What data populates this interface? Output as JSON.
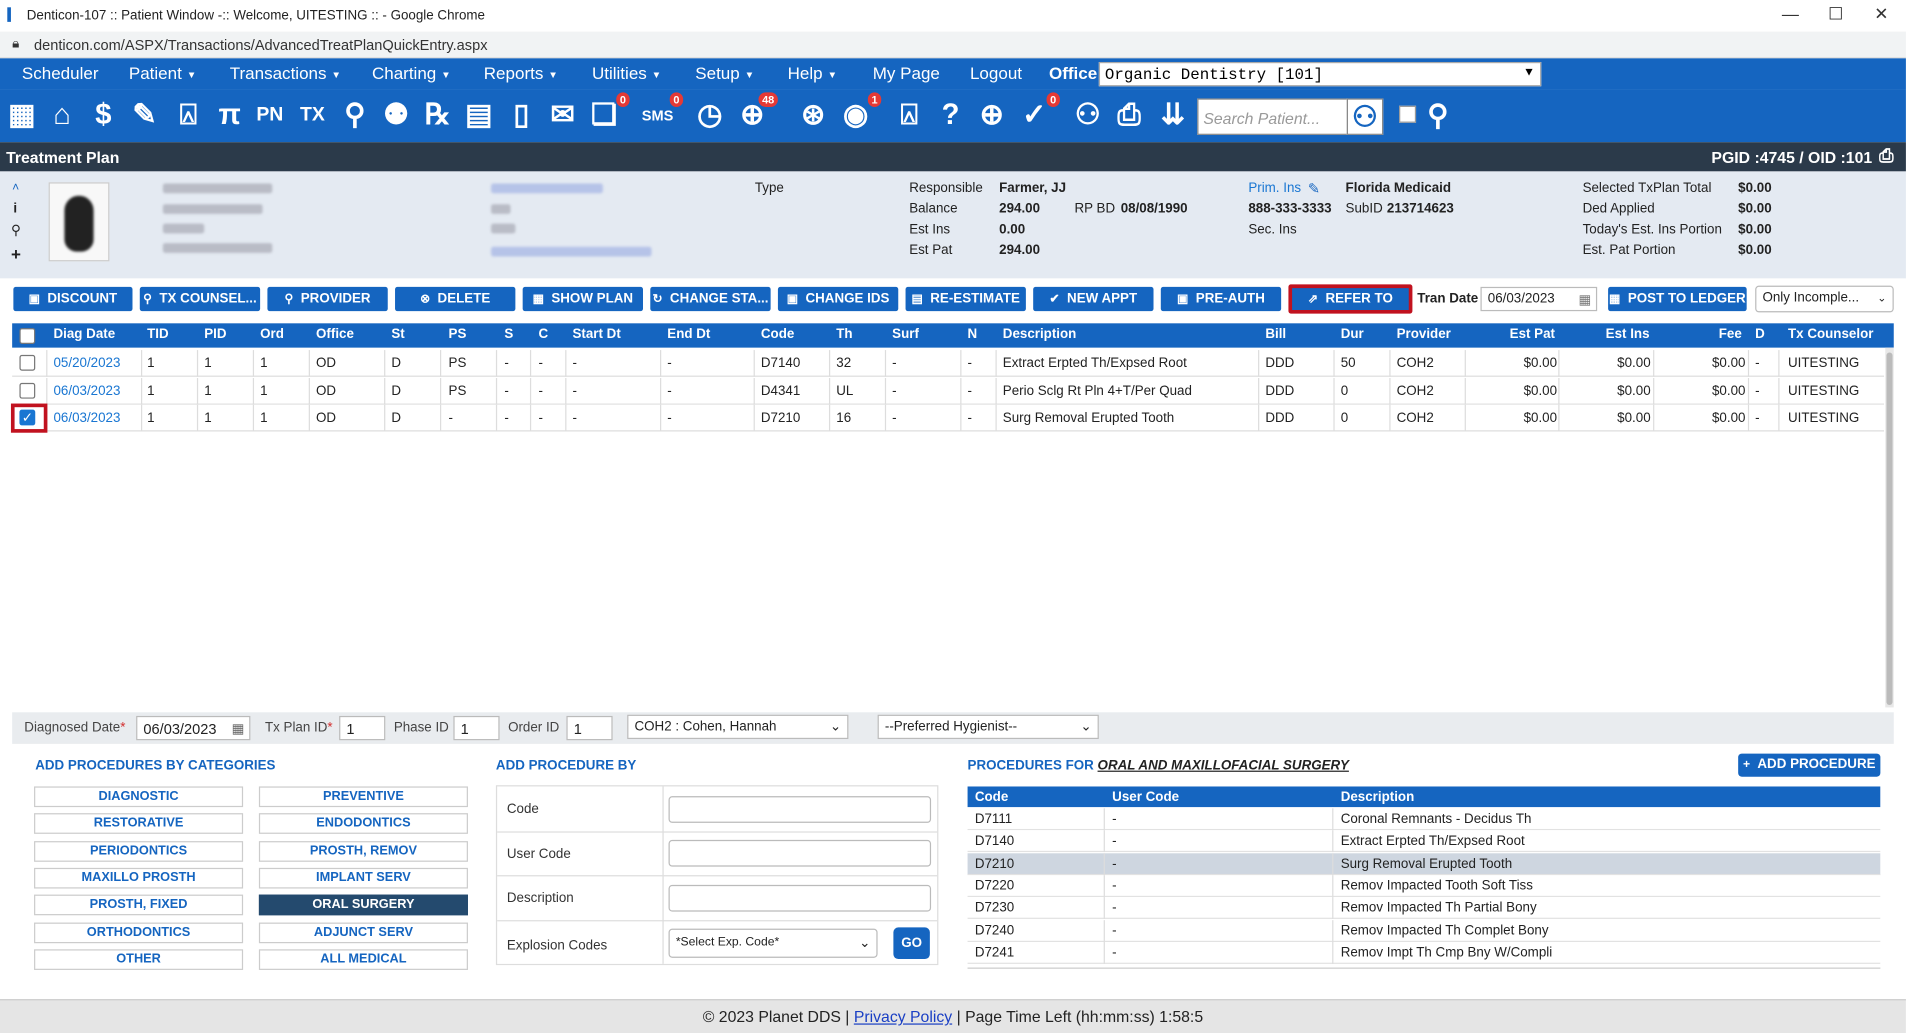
{
  "window": {
    "title": "Denticon-107 :: Patient Window -:: Welcome, UITESTING :: - Google Chrome",
    "url": "denticon.com/ASPX/Transactions/AdvancedTreatPlanQuickEntry.aspx",
    "min": "—",
    "max": "☐",
    "close": "✕"
  },
  "menu": {
    "items": [
      "Scheduler",
      "Patient",
      "Transactions",
      "Charting",
      "Reports",
      "Utilities",
      "Setup",
      "Help",
      "My Page",
      "Logout"
    ],
    "dropdown_caret": "▼",
    "office_label": "Office",
    "office_value": "Organic Dentistry [101]"
  },
  "iconbar": {
    "search_placeholder": "Search Patient...",
    "badges": {
      "sms": "0",
      "globe": "48",
      "alert": "1",
      "msg": "0",
      "claim": "0"
    }
  },
  "treatment_plan": {
    "title": "Treatment Plan",
    "pgid": "PGID :4745  /  OID :101"
  },
  "patient": {
    "type_label": "Type",
    "responsible_label": "Responsible",
    "responsible_value": "Farmer, JJ",
    "balance_label": "Balance",
    "balance_value": "294.00",
    "rpbd_label": "RP BD",
    "rpbd_value": "08/08/1990",
    "estins_label": "Est Ins",
    "estins_value": "0.00",
    "estpat_label": "Est Pat",
    "estpat_value": "294.00",
    "primins_label": "Prim. Ins",
    "primins_value": "Florida Medicaid",
    "phone": "888-333-3333",
    "subid_label": "SubID",
    "subid_value": "213714623",
    "secins_label": "Sec. Ins",
    "totals": [
      [
        "Selected TxPlan Total",
        "$0.00"
      ],
      [
        "Ded Applied",
        "$0.00"
      ],
      [
        "Today's Est. Ins Portion",
        "$0.00"
      ],
      [
        "Est. Pat Portion",
        "$0.00"
      ]
    ]
  },
  "buttons": [
    "DISCOUNT",
    "TX COUNSEL...",
    "PROVIDER",
    "DELETE",
    "SHOW PLAN",
    "CHANGE STA...",
    "CHANGE IDS",
    "RE-ESTIMATE",
    "NEW APPT",
    "PRE-AUTH",
    "REFER TO"
  ],
  "tran_date_label": "Tran Date",
  "tran_date_value": "06/03/2023",
  "post_ledger": "POST TO LEDGER",
  "filter_select": "Only Incomple...",
  "grid": {
    "headers": [
      "Diag Date",
      "TID",
      "PID",
      "Ord",
      "Office",
      "St",
      "PS",
      "S",
      "C",
      "Start Dt",
      "End Dt",
      "Code",
      "Th",
      "Surf",
      "N",
      "Description",
      "Bill",
      "Dur",
      "Provider",
      "Est Pat",
      "Est Ins",
      "Fee",
      "D",
      "Tx Counselor"
    ],
    "rows": [
      [
        "05/20/2023",
        "1",
        "1",
        "1",
        "OD",
        "D",
        "PS",
        "-",
        "-",
        "-",
        "-",
        "D7140",
        "32",
        "-",
        "-",
        "Extract Erpted Th/Expsed Root",
        "DDD",
        "50",
        "COH2",
        "$0.00",
        "$0.00",
        "$0.00",
        "-",
        "UITESTING"
      ],
      [
        "06/03/2023",
        "1",
        "1",
        "1",
        "OD",
        "D",
        "PS",
        "-",
        "-",
        "-",
        "-",
        "D4341",
        "UL",
        "-",
        "-",
        "Perio Sclg Rt Pln 4+T/Per Quad",
        "DDD",
        "0",
        "COH2",
        "$0.00",
        "$0.00",
        "$0.00",
        "-",
        "UITESTING"
      ],
      [
        "06/03/2023",
        "1",
        "1",
        "1",
        "OD",
        "D",
        "-",
        "-",
        "-",
        "-",
        "-",
        "D7210",
        "16",
        "-",
        "-",
        "Surg Removal Erupted Tooth",
        "DDD",
        "0",
        "COH2",
        "$0.00",
        "$0.00",
        "$0.00",
        "-",
        "UITESTING"
      ]
    ],
    "checked": [
      false,
      false,
      true
    ]
  },
  "filter": {
    "diag_label": "Diagnosed Date",
    "diag_value": "06/03/2023",
    "txplan_label": "Tx Plan ID",
    "txplan_value": "1",
    "phase_label": "Phase ID",
    "phase_value": "1",
    "order_label": "Order ID",
    "order_value": "1",
    "provider_value": "COH2 : Cohen, Hannah",
    "hygienist_value": "--Preferred Hygienist--"
  },
  "categories": {
    "title": "ADD PROCEDURES BY CATEGORIES",
    "left": [
      "DIAGNOSTIC",
      "RESTORATIVE",
      "PERIODONTICS",
      "MAXILLO PROSTH",
      "PROSTH, FIXED",
      "ORTHODONTICS",
      "OTHER"
    ],
    "right": [
      "PREVENTIVE",
      "ENDODONTICS",
      "PROSTH, REMOV",
      "IMPLANT SERV",
      "ORAL SURGERY",
      "ADJUNCT SERV",
      "ALL MEDICAL"
    ],
    "active": "ORAL SURGERY"
  },
  "addby": {
    "title": "ADD PROCEDURE BY",
    "fields": [
      "Code",
      "User Code",
      "Description",
      "Explosion Codes"
    ],
    "explosion_select": "*Select Exp. Code*",
    "go": "GO"
  },
  "procedures": {
    "title_prefix": "PROCEDURES FOR",
    "title_category": "ORAL AND MAXILLOFACIAL SURGERY",
    "add_button": "ADD PROCEDURE",
    "headers": [
      "Code",
      "User Code",
      "Description"
    ],
    "rows": [
      [
        "D7111",
        "-",
        "Coronal Remnants - Decidus Th"
      ],
      [
        "D7140",
        "-",
        "Extract Erpted Th/Expsed Root"
      ],
      [
        "D7210",
        "-",
        "Surg Removal Erupted Tooth"
      ],
      [
        "D7220",
        "-",
        "Remov Impacted Tooth Soft Tiss"
      ],
      [
        "D7230",
        "-",
        "Remov Impacted Th Partial Bony"
      ],
      [
        "D7240",
        "-",
        "Remov Impacted Th Complet Bony"
      ],
      [
        "D7241",
        "-",
        "Remov Impt Th Cmp Bny W/Compli"
      ]
    ],
    "selected_index": 2
  },
  "footer": {
    "copyright": "© 2023 Planet DDS |",
    "privacy": "Privacy Policy",
    "time_label": "| Page Time Left (hh:mm:ss)",
    "time_value": "1:58:5"
  }
}
